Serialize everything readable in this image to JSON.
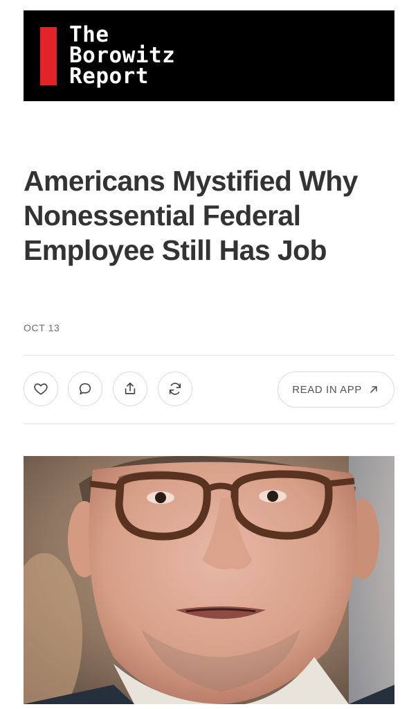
{
  "masthead": {
    "logo_lines": [
      "The",
      "Borowitz",
      "Report"
    ],
    "accent_color": "#e3232a"
  },
  "article": {
    "headline": "Americans Mystified Why Nonessential Federal Employee Still Has Job",
    "date": "OCT 13"
  },
  "actions": {
    "like_icon": "heart-icon",
    "comment_icon": "speech-bubble-icon",
    "share_icon": "share-icon",
    "restack_icon": "restack-icon",
    "read_in_app_label": "READ IN APP",
    "read_in_app_icon": "arrow-up-right-icon"
  },
  "photo": {
    "subject": "close-up portrait of a man wearing tortoiseshell glasses"
  }
}
